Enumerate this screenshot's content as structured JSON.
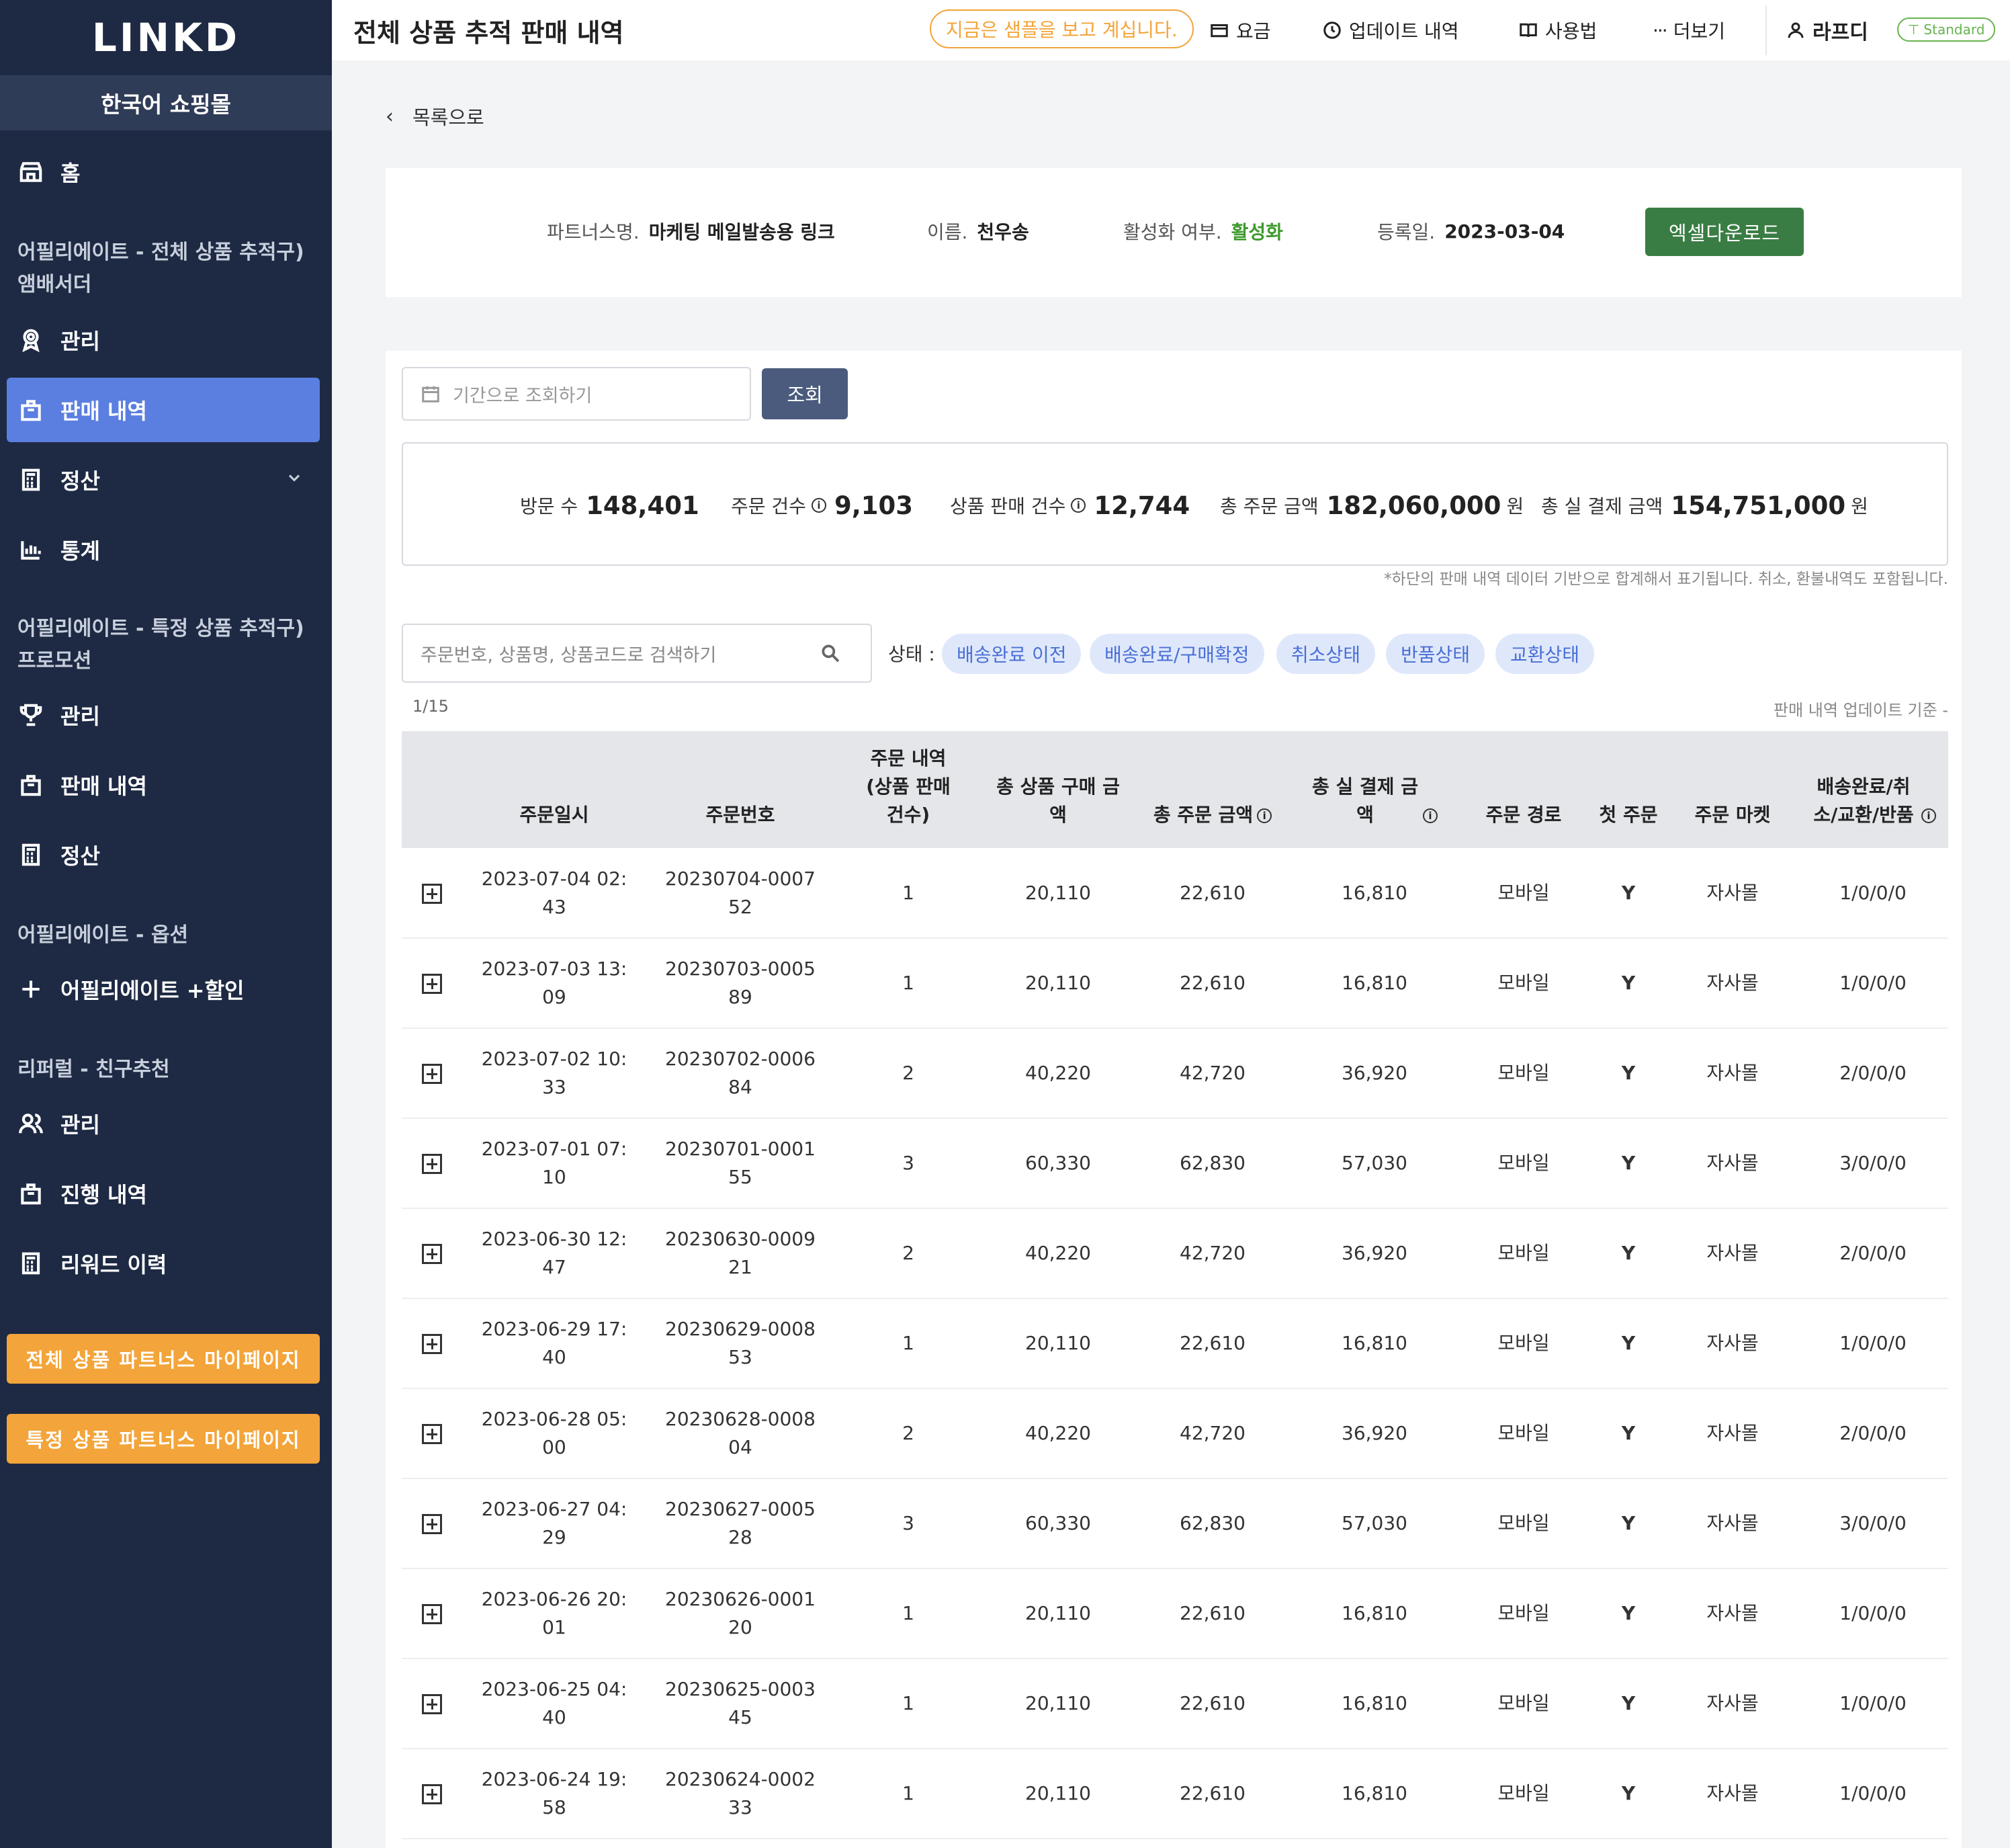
{
  "sidebar": {
    "logo": "LINKD",
    "shop_name": "한국어 쇼핑몰",
    "home": "홈",
    "section1": "어필리에이트 - 전체 상품 추적구) 앰배서더",
    "s1_manage": "관리",
    "s1_sales": "판매 내역",
    "s1_settle": "정산",
    "s1_stats": "통계",
    "section2": "어필리에이트 - 특정 상품 추적구) 프로모션",
    "s2_manage": "관리",
    "s2_sales": "판매 내역",
    "s2_settle": "정산",
    "section3": "어필리에이트 - 옵션",
    "s3_discount": "어필리에이트 +할인",
    "section4": "리퍼럴 - 친구추천",
    "s4_manage": "관리",
    "s4_progress": "진행 내역",
    "s4_reward": "리워드 이력",
    "btn_all": "전체 상품 파트너스 마이페이지",
    "btn_specific": "특정 상품 파트너스 마이페이지"
  },
  "header": {
    "title": "전체 상품 추적 판매 내역",
    "sample_notice": "지금은 샘플을 보고 계십니다.",
    "pricing": "요금",
    "updates": "업데이트 내역",
    "usage": "사용법",
    "more": "더보기",
    "user": "라프디",
    "plan": "Standard"
  },
  "back_label": "목록으로",
  "partner": {
    "name_label": "파트너스명.",
    "name_value": "마케팅 메일발송용 링크",
    "person_label": "이름.",
    "person_value": "천우송",
    "active_label": "활성화 여부.",
    "active_value": "활성화",
    "reg_label": "등록일.",
    "reg_value": "2023-03-04",
    "excel_btn": "엑셀다운로드"
  },
  "filter": {
    "date_placeholder": "기간으로 조회하기",
    "query_btn": "조회",
    "search_placeholder": "주문번호, 상품명, 상품코드로 검색하기",
    "status_label": "상태 :",
    "chips": [
      "배송완료 이전",
      "배송완료/구매확정",
      "취소상태",
      "반품상태",
      "교환상태"
    ]
  },
  "stats": {
    "visits_label": "방문 수",
    "visits": "148,401",
    "orders_label": "주문 건수",
    "orders": "9,103",
    "items_label": "상품 판매 건수",
    "items": "12,744",
    "total_label": "총 주문 금액",
    "total": "182,060,000",
    "paid_label": "총 실 결제 금액",
    "paid": "154,751,000",
    "unit": "원",
    "note": "*하단의 판매 내역 데이터 기반으로 합계해서 표기됩니다. 취소, 환불내역도 포함됩니다."
  },
  "table_meta": {
    "page": "1/15",
    "update_note": "판매 내역 업데이트 기준 -"
  },
  "columns": [
    "주문일시",
    "주문번호",
    "주문 내역 (상품 판매 건수)",
    "총 상품 구매 금액",
    "총 주문 금액",
    "총 실 결제 금액",
    "주문 경로",
    "첫 주문",
    "주문 마켓",
    "배송완료/취소/교환/반품"
  ],
  "rows": [
    [
      "2023-07-04 02:43",
      "20230704-000752",
      "1",
      "20,110",
      "22,610",
      "16,810",
      "모바일",
      "Y",
      "자사몰",
      "1/0/0/0"
    ],
    [
      "2023-07-03 13:09",
      "20230703-000589",
      "1",
      "20,110",
      "22,610",
      "16,810",
      "모바일",
      "Y",
      "자사몰",
      "1/0/0/0"
    ],
    [
      "2023-07-02 10:33",
      "20230702-000684",
      "2",
      "40,220",
      "42,720",
      "36,920",
      "모바일",
      "Y",
      "자사몰",
      "2/0/0/0"
    ],
    [
      "2023-07-01 07:10",
      "20230701-000155",
      "3",
      "60,330",
      "62,830",
      "57,030",
      "모바일",
      "Y",
      "자사몰",
      "3/0/0/0"
    ],
    [
      "2023-06-30 12:47",
      "20230630-000921",
      "2",
      "40,220",
      "42,720",
      "36,920",
      "모바일",
      "Y",
      "자사몰",
      "2/0/0/0"
    ],
    [
      "2023-06-29 17:40",
      "20230629-000853",
      "1",
      "20,110",
      "22,610",
      "16,810",
      "모바일",
      "Y",
      "자사몰",
      "1/0/0/0"
    ],
    [
      "2023-06-28 05:00",
      "20230628-000804",
      "2",
      "40,220",
      "42,720",
      "36,920",
      "모바일",
      "Y",
      "자사몰",
      "2/0/0/0"
    ],
    [
      "2023-06-27 04:29",
      "20230627-000528",
      "3",
      "60,330",
      "62,830",
      "57,030",
      "모바일",
      "Y",
      "자사몰",
      "3/0/0/0"
    ],
    [
      "2023-06-26 20:01",
      "20230626-000120",
      "1",
      "20,110",
      "22,610",
      "16,810",
      "모바일",
      "Y",
      "자사몰",
      "1/0/0/0"
    ],
    [
      "2023-06-25 04:40",
      "20230625-000345",
      "1",
      "20,110",
      "22,610",
      "16,810",
      "모바일",
      "Y",
      "자사몰",
      "1/0/0/0"
    ],
    [
      "2023-06-24 19:58",
      "20230624-000233",
      "1",
      "20,110",
      "22,610",
      "16,810",
      "모바일",
      "Y",
      "자사몰",
      "1/0/0/0"
    ]
  ],
  "colors": {
    "sidebar": "#1e2a44",
    "active": "#5b7fe0",
    "accent": "#f3a43a",
    "excel": "#3a7d44",
    "chip": "#dfe8fb"
  }
}
